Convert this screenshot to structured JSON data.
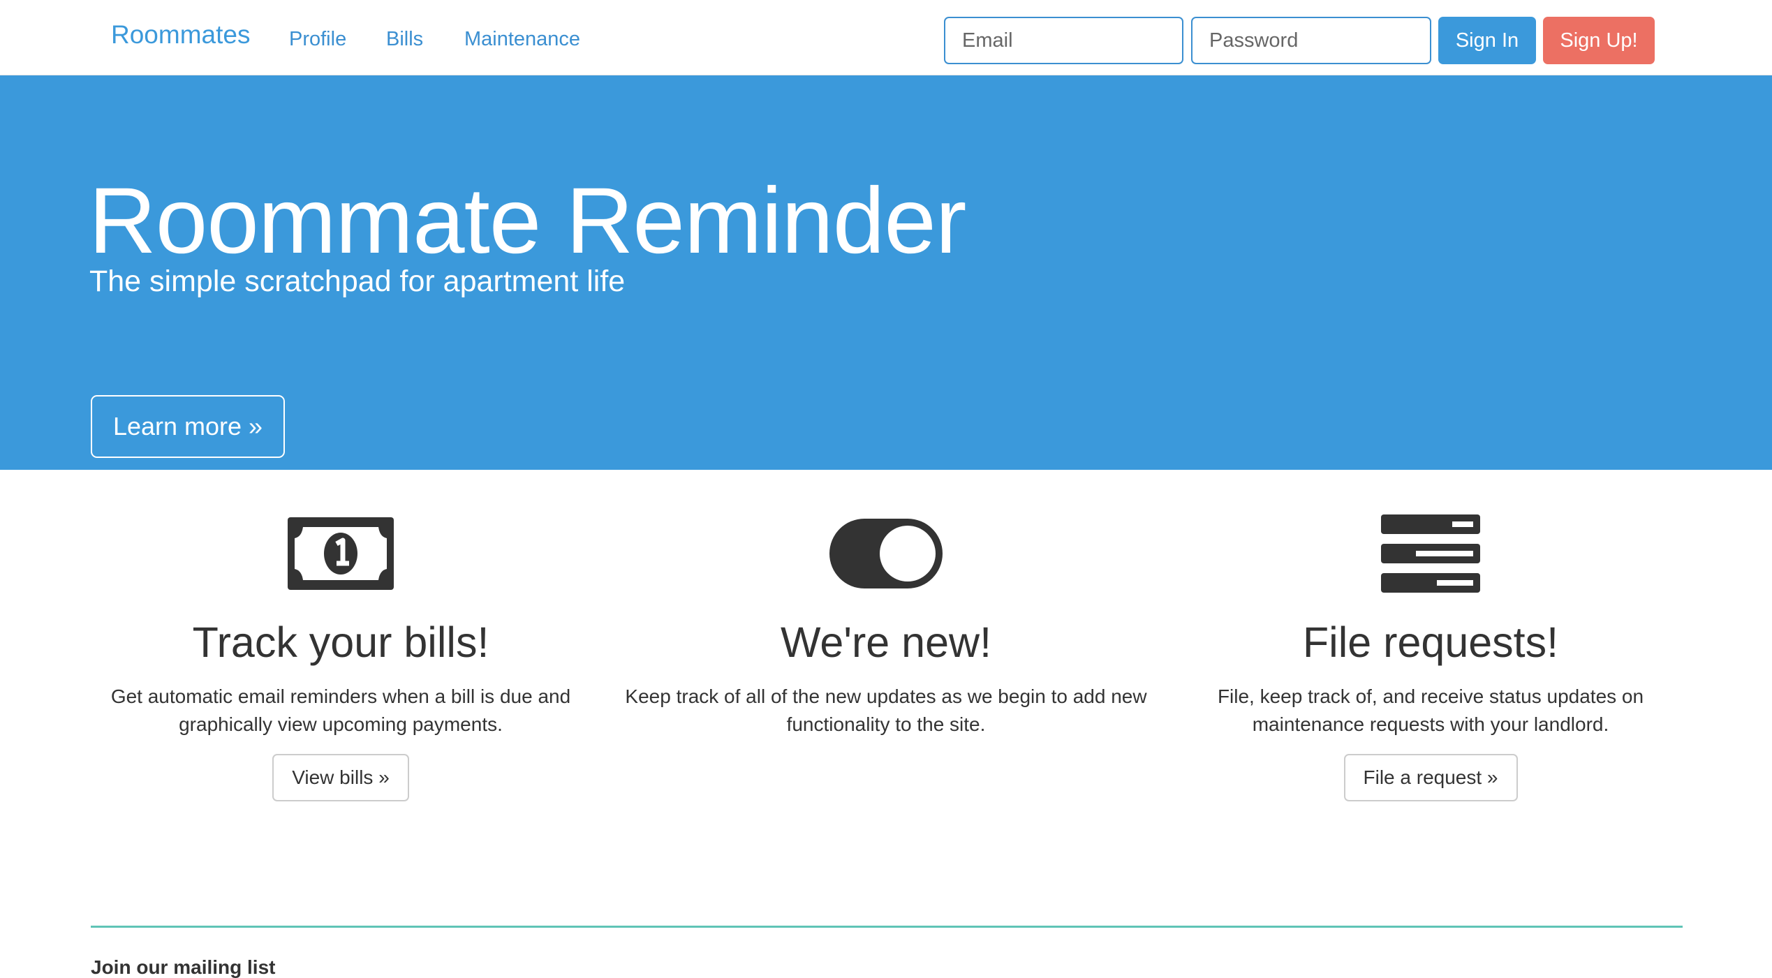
{
  "navbar": {
    "brand": "Roommates",
    "links": [
      "Profile",
      "Bills",
      "Maintenance"
    ],
    "email_placeholder": "Email",
    "password_placeholder": "Password",
    "signin_label": "Sign In",
    "signup_label": "Sign Up!"
  },
  "hero": {
    "title": "Roommate Reminder",
    "subtitle": "The simple scratchpad for apartment life",
    "button_label": "Learn more »"
  },
  "features": [
    {
      "icon": "money-bill-icon",
      "heading": "Track your bills!",
      "text": "Get automatic email reminders when a bill is due and graphically view upcoming payments.",
      "button_label": "View bills »"
    },
    {
      "icon": "toggle-icon",
      "heading": "We're new!",
      "text": "Keep track of all of the new updates as we begin to add new functionality to the site."
    },
    {
      "icon": "server-list-icon",
      "heading": "File requests!",
      "text": "File, keep track of, and receive status updates on maintenance requests with your landlord.",
      "button_label": "File a request »"
    }
  ],
  "footer": {
    "mailing_label": "Join our mailing list"
  },
  "colors": {
    "primary": "#3b99db",
    "danger": "#ec7063",
    "divider": "#5fc4b6",
    "icon": "#333333"
  }
}
